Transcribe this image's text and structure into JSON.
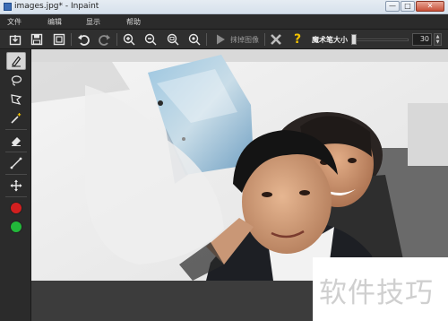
{
  "window": {
    "title": "images.jpg* - Inpaint",
    "min_label": "—",
    "max_label": "□",
    "close_label": "✕"
  },
  "menu": {
    "items": [
      {
        "label": "文件"
      },
      {
        "label": "编辑"
      },
      {
        "label": "显示"
      },
      {
        "label": "帮助"
      }
    ]
  },
  "toolbar": {
    "erase_label": "抹掉图像",
    "help_label": "?",
    "brush_size_label": "魔术笔大小",
    "brush_size_value": "30",
    "brush_size_fraction": 0.05,
    "spin_up": "▲",
    "spin_down": "▼",
    "icons": [
      "open-file-icon",
      "save-icon",
      "save-as-icon",
      "undo-icon",
      "redo-icon",
      "zoom-in-icon",
      "zoom-out-icon",
      "zoom-actual-icon",
      "zoom-fit-icon",
      "play-icon",
      "cancel-icon",
      "help-icon"
    ]
  },
  "sidebar": {
    "tools": [
      "marker-tool",
      "lasso-tool",
      "polygon-lasso-tool",
      "magic-wand-tool",
      "eraser-tool",
      "line-tool",
      "move-tool"
    ],
    "colors": [
      "#d21f1f",
      "#22b83a"
    ]
  },
  "watermark": {
    "text": "软件技巧"
  }
}
